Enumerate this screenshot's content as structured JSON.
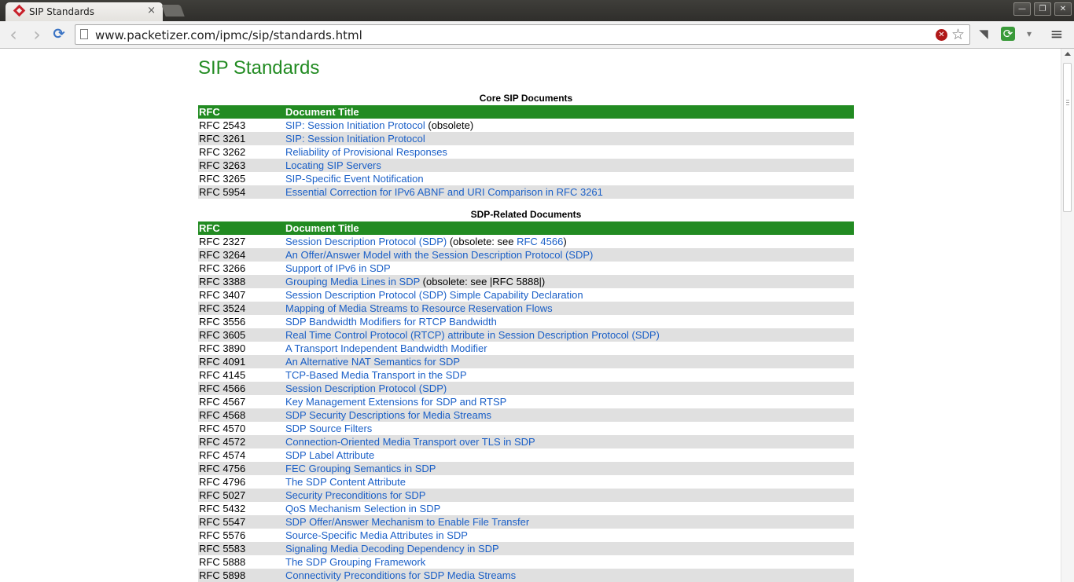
{
  "browser": {
    "tab_title": "SIP Standards",
    "tab_close": "×",
    "url": "www.packetizer.com/ipmc/sip/standards.html",
    "window_buttons": {
      "minimize": "—",
      "restore": "❐",
      "close": "✕"
    },
    "nav": {
      "back": "‹",
      "forward": "›",
      "reload": "⟳"
    },
    "icons": {
      "stop": "✕",
      "star": "☆",
      "pocket": "◥",
      "extension": "⟳",
      "dropdown": "▾",
      "menu": "≡"
    }
  },
  "page": {
    "title": "SIP Standards",
    "core_section": {
      "title": "Core SIP Documents",
      "headers": {
        "rfc": "RFC",
        "doc": "Document Title"
      },
      "rows": [
        {
          "rfc": "RFC 2543",
          "title": "SIP: Session Initiation Protocol",
          "note": " (obsolete)",
          "note_link": "",
          "note_end": ""
        },
        {
          "rfc": "RFC 3261",
          "title": "SIP: Session Initiation Protocol",
          "note": "",
          "note_link": "",
          "note_end": ""
        },
        {
          "rfc": "RFC 3262",
          "title": "Reliability of Provisional Responses",
          "note": "",
          "note_link": "",
          "note_end": ""
        },
        {
          "rfc": "RFC 3263",
          "title": "Locating SIP Servers",
          "note": "",
          "note_link": "",
          "note_end": ""
        },
        {
          "rfc": "RFC 3265",
          "title": "SIP-Specific Event Notification",
          "note": "",
          "note_link": "",
          "note_end": ""
        },
        {
          "rfc": "RFC 5954",
          "title": "Essential Correction for IPv6 ABNF and URI Comparison in RFC 3261",
          "note": "",
          "note_link": "",
          "note_end": ""
        }
      ]
    },
    "sdp_section": {
      "title": "SDP-Related Documents",
      "headers": {
        "rfc": "RFC",
        "doc": "Document Title"
      },
      "rows": [
        {
          "rfc": "RFC 2327",
          "title": "Session Description Protocol (SDP)",
          "note": " (obsolete: see ",
          "note_link": "RFC 4566",
          "note_end": ")"
        },
        {
          "rfc": "RFC 3264",
          "title": "An Offer/Answer Model with the Session Description Protocol (SDP)",
          "note": "",
          "note_link": "",
          "note_end": ""
        },
        {
          "rfc": "RFC 3266",
          "title": "Support of IPv6 in SDP",
          "note": "",
          "note_link": "",
          "note_end": ""
        },
        {
          "rfc": "RFC 3388",
          "title": "Grouping Media Lines in SDP",
          "note": " (obsolete: see |RFC 5888|)",
          "note_link": "",
          "note_end": ""
        },
        {
          "rfc": "RFC 3407",
          "title": "Session Description Protocol (SDP) Simple Capability Declaration",
          "note": "",
          "note_link": "",
          "note_end": ""
        },
        {
          "rfc": "RFC 3524",
          "title": "Mapping of Media Streams to Resource Reservation Flows",
          "note": "",
          "note_link": "",
          "note_end": ""
        },
        {
          "rfc": "RFC 3556",
          "title": "SDP Bandwidth Modifiers for RTCP Bandwidth",
          "note": "",
          "note_link": "",
          "note_end": ""
        },
        {
          "rfc": "RFC 3605",
          "title": "Real Time Control Protocol (RTCP) attribute in Session Description Protocol (SDP)",
          "note": "",
          "note_link": "",
          "note_end": ""
        },
        {
          "rfc": "RFC 3890",
          "title": "A Transport Independent Bandwidth Modifier",
          "note": "",
          "note_link": "",
          "note_end": ""
        },
        {
          "rfc": "RFC 4091",
          "title": "An Alternative NAT Semantics for SDP",
          "note": "",
          "note_link": "",
          "note_end": ""
        },
        {
          "rfc": "RFC 4145",
          "title": "TCP-Based Media Transport in the SDP",
          "note": "",
          "note_link": "",
          "note_end": ""
        },
        {
          "rfc": "RFC 4566",
          "title": "Session Description Protocol (SDP)",
          "note": "",
          "note_link": "",
          "note_end": ""
        },
        {
          "rfc": "RFC 4567",
          "title": "Key Management Extensions for SDP and RTSP",
          "note": "",
          "note_link": "",
          "note_end": ""
        },
        {
          "rfc": "RFC 4568",
          "title": "SDP Security Descriptions for Media Streams",
          "note": "",
          "note_link": "",
          "note_end": ""
        },
        {
          "rfc": "RFC 4570",
          "title": "SDP Source Filters",
          "note": "",
          "note_link": "",
          "note_end": ""
        },
        {
          "rfc": "RFC 4572",
          "title": "Connection-Oriented Media Transport over TLS in SDP",
          "note": "",
          "note_link": "",
          "note_end": ""
        },
        {
          "rfc": "RFC 4574",
          "title": "SDP Label Attribute",
          "note": "",
          "note_link": "",
          "note_end": ""
        },
        {
          "rfc": "RFC 4756",
          "title": "FEC Grouping Semantics in SDP",
          "note": "",
          "note_link": "",
          "note_end": ""
        },
        {
          "rfc": "RFC 4796",
          "title": "The SDP Content Attribute",
          "note": "",
          "note_link": "",
          "note_end": ""
        },
        {
          "rfc": "RFC 5027",
          "title": "Security Preconditions for SDP",
          "note": "",
          "note_link": "",
          "note_end": ""
        },
        {
          "rfc": "RFC 5432",
          "title": "QoS Mechanism Selection in SDP",
          "note": "",
          "note_link": "",
          "note_end": ""
        },
        {
          "rfc": "RFC 5547",
          "title": "SDP Offer/Answer Mechanism to Enable File Transfer",
          "note": "",
          "note_link": "",
          "note_end": ""
        },
        {
          "rfc": "RFC 5576",
          "title": "Source-Specific Media Attributes in SDP",
          "note": "",
          "note_link": "",
          "note_end": ""
        },
        {
          "rfc": "RFC 5583",
          "title": "Signaling Media Decoding Dependency in SDP",
          "note": "",
          "note_link": "",
          "note_end": ""
        },
        {
          "rfc": "RFC 5888",
          "title": "The SDP Grouping Framework",
          "note": "",
          "note_link": "",
          "note_end": ""
        },
        {
          "rfc": "RFC 5898",
          "title": "Connectivity Preconditions for SDP Media Streams",
          "note": "",
          "note_link": "",
          "note_end": ""
        }
      ]
    }
  },
  "colors": {
    "accent": "#228b22",
    "link": "#1a5fc7",
    "row_alt": "#e0e0e0"
  }
}
